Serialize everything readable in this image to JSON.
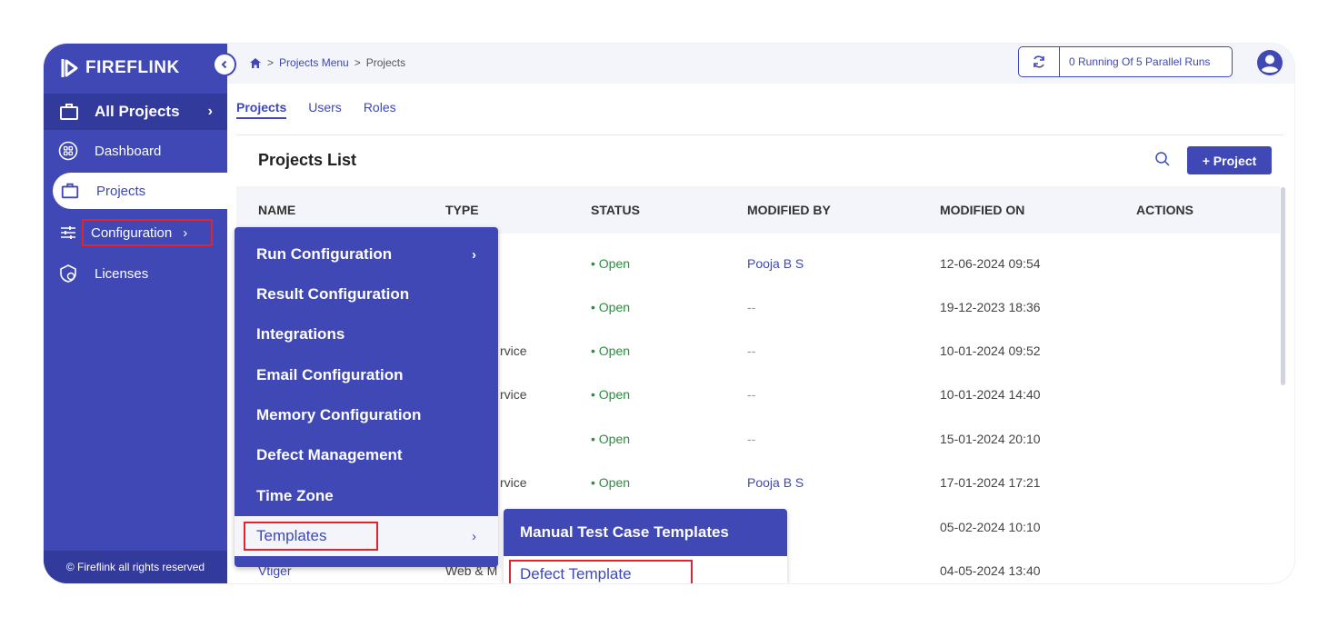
{
  "brand": {
    "name": "FIREFLINK"
  },
  "sidebar": {
    "all_projects": "All Projects",
    "items": [
      {
        "label": "Dashboard",
        "icon": "dashboard-icon"
      },
      {
        "label": "Projects",
        "icon": "briefcase-icon",
        "active": true
      },
      {
        "label": "Configuration",
        "icon": "sliders-icon"
      },
      {
        "label": "Licenses",
        "icon": "license-icon"
      }
    ],
    "copyright": "© Fireflink all rights reserved"
  },
  "topbar": {
    "breadcrumb": [
      "Projects Menu",
      "Projects"
    ],
    "parallel_runs": "0 Running Of 5 Parallel Runs"
  },
  "tabs": [
    "Projects",
    "Users",
    "Roles"
  ],
  "list": {
    "title": "Projects List",
    "add_button": "+ Project",
    "columns": [
      "NAME",
      "TYPE",
      "STATUS",
      "MODIFIED BY",
      "MODIFIED ON",
      "ACTIONS"
    ],
    "rows": [
      {
        "name": "",
        "type": "",
        "status": "Open",
        "modified_by": "Pooja B S",
        "modified_on": "12-06-2024 09:54"
      },
      {
        "name": "",
        "type": "",
        "status": "Open",
        "modified_by": "--",
        "modified_on": "19-12-2023 18:36"
      },
      {
        "name": "",
        "type": "rvice",
        "status": "Open",
        "modified_by": "--",
        "modified_on": "10-01-2024 09:52"
      },
      {
        "name": "",
        "type": "rvice",
        "status": "Open",
        "modified_by": "--",
        "modified_on": "10-01-2024 14:40"
      },
      {
        "name": "",
        "type": "",
        "status": "Open",
        "modified_by": "--",
        "modified_on": "15-01-2024 20:10"
      },
      {
        "name": "",
        "type": "rvice",
        "status": "Open",
        "modified_by": "Pooja B S",
        "modified_on": "17-01-2024 17:21"
      },
      {
        "name": "",
        "type": "",
        "status": "",
        "modified_by": "",
        "modified_on": "05-02-2024 10:10"
      },
      {
        "name": "Vtiger",
        "type": "Web & M",
        "status": "",
        "modified_by": "",
        "modified_on": "04-05-2024 13:40"
      }
    ]
  },
  "config_menu": {
    "items": [
      {
        "label": "Run Configuration",
        "has_submenu": true
      },
      {
        "label": "Result Configuration"
      },
      {
        "label": "Integrations"
      },
      {
        "label": "Email Configuration"
      },
      {
        "label": "Memory Configuration"
      },
      {
        "label": "Defect Management"
      },
      {
        "label": "Time Zone"
      },
      {
        "label": "Templates",
        "has_submenu": true,
        "highlighted": true
      }
    ]
  },
  "templates_submenu": [
    "Manual Test Case Templates",
    "Defect Template"
  ],
  "colors": {
    "primary": "#3f48b4",
    "status_open": "#2e8b3f",
    "highlight_box": "#e0252e"
  }
}
